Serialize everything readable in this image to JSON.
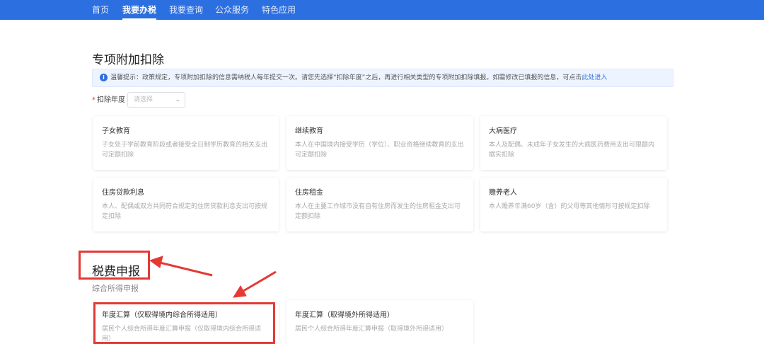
{
  "nav": {
    "items": [
      {
        "label": "首页",
        "active": false
      },
      {
        "label": "我要办税",
        "active": true
      },
      {
        "label": "我要查询",
        "active": false
      },
      {
        "label": "公众服务",
        "active": false
      },
      {
        "label": "特色应用",
        "active": false
      }
    ]
  },
  "special_deduction": {
    "title": "专项附加扣除",
    "notice_text": "温馨提示：政策规定，专项附加扣除的信息需纳税人每年提交一次。请您先选择“扣除年度”之后，再进行相关类型的专项附加扣除填报。如需修改已填报的信息，可点击",
    "notice_link": "此处进入",
    "year_label": "扣除年度",
    "year_placeholder": "请选择",
    "cards": [
      {
        "title": "子女教育",
        "desc": "子女处于学前教育阶段或者接受全日制学历教育的相关支出可定额扣除"
      },
      {
        "title": "继续教育",
        "desc": "本人在中国境内接受学历（学位）、职业资格继续教育的支出可定额扣除"
      },
      {
        "title": "大病医疗",
        "desc": "本人及配偶、未成年子女发生的大病医药费用支出可限额内据实扣除"
      },
      {
        "title": "住房贷款利息",
        "desc": "本人、配偶或双方共同符合规定的住房贷款利息支出可按规定扣除"
      },
      {
        "title": "住房租金",
        "desc": "本人在主要工作城市没有自有住房而发生的住房租金支出可定额扣除"
      },
      {
        "title": "赡养老人",
        "desc": "本人赡养年满60岁（含）的父母等其他情形可按规定扣除"
      }
    ]
  },
  "tax_declaration": {
    "title": "税费申报",
    "subtitle": "综合所得申报",
    "cards": [
      {
        "title": "年度汇算（仅取得境内综合所得适用）",
        "desc": "居民个人综合所得年度汇算申报（仅取得境内综合所得适用）"
      },
      {
        "title": "年度汇算（取得境外所得适用）",
        "desc": "居民个人综合所得年度汇算申报（取得境外所得适用）"
      }
    ]
  },
  "colors": {
    "nav_bg": "#2b6fe0",
    "annotation": "#e53935",
    "link": "#2b6fe0"
  }
}
